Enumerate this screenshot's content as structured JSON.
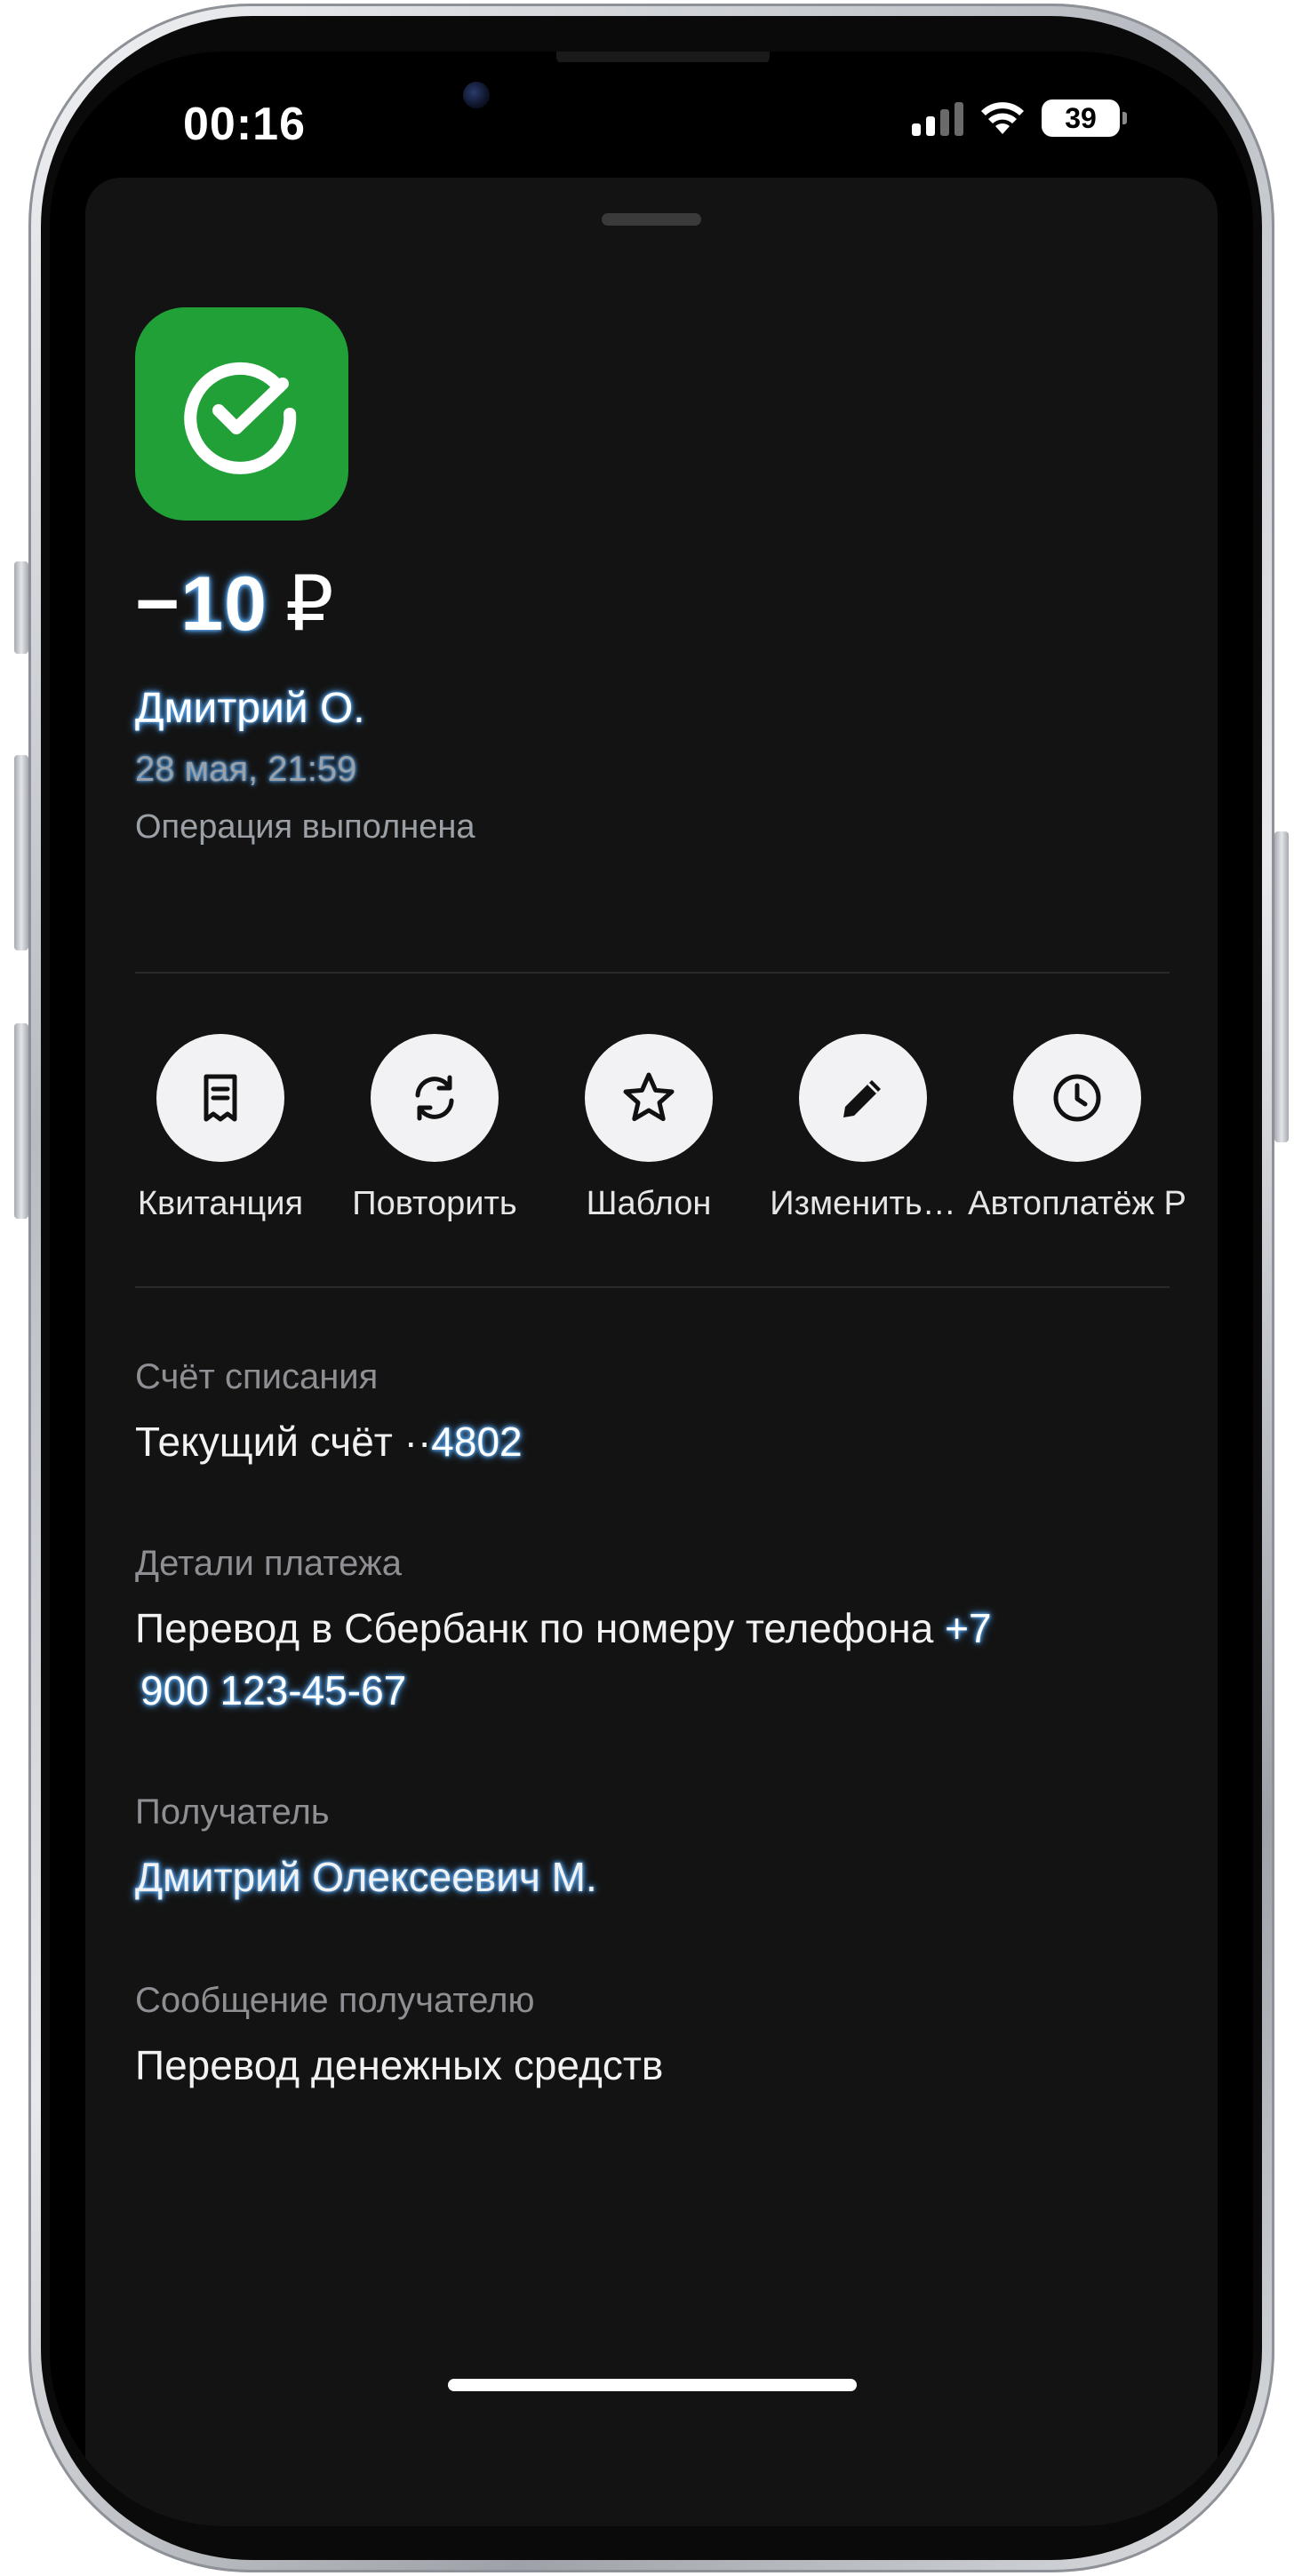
{
  "status_bar": {
    "time": "00:16",
    "battery": "39"
  },
  "operation": {
    "amount_prefix": "−",
    "amount": "10",
    "currency": "₽",
    "sender": "Дмитрий О.",
    "datetime": "28 мая, 21:59",
    "status": "Операция выполнена"
  },
  "actions": [
    {
      "label": "Квитанция",
      "icon": "receipt-icon"
    },
    {
      "label": "Повторить",
      "icon": "repeat-icon"
    },
    {
      "label": "Шаблон",
      "icon": "star-icon"
    },
    {
      "label": "Изменить…",
      "icon": "pencil-icon"
    },
    {
      "label": "Автоплатёж Р",
      "icon": "clock-icon"
    }
  ],
  "details": {
    "account_label": "Счёт списания",
    "account_value_prefix": "Текущий счёт ··",
    "account_number": "4802",
    "payment_label": "Детали платежа",
    "payment_value_prefix": "Перевод в Сбербанк по номеру телефона ",
    "payment_phone_code": "+7",
    "payment_phone": "900 123-45-67",
    "recipient_label": "Получатель",
    "recipient_value": "Дмитрий Олексеевич М.",
    "message_label": "Сообщение получателю",
    "message_value": "Перевод денежных средств"
  },
  "colors": {
    "brand_green": "#21a038",
    "sheet_background": "#131313",
    "highlight": "#5aa8f0"
  }
}
